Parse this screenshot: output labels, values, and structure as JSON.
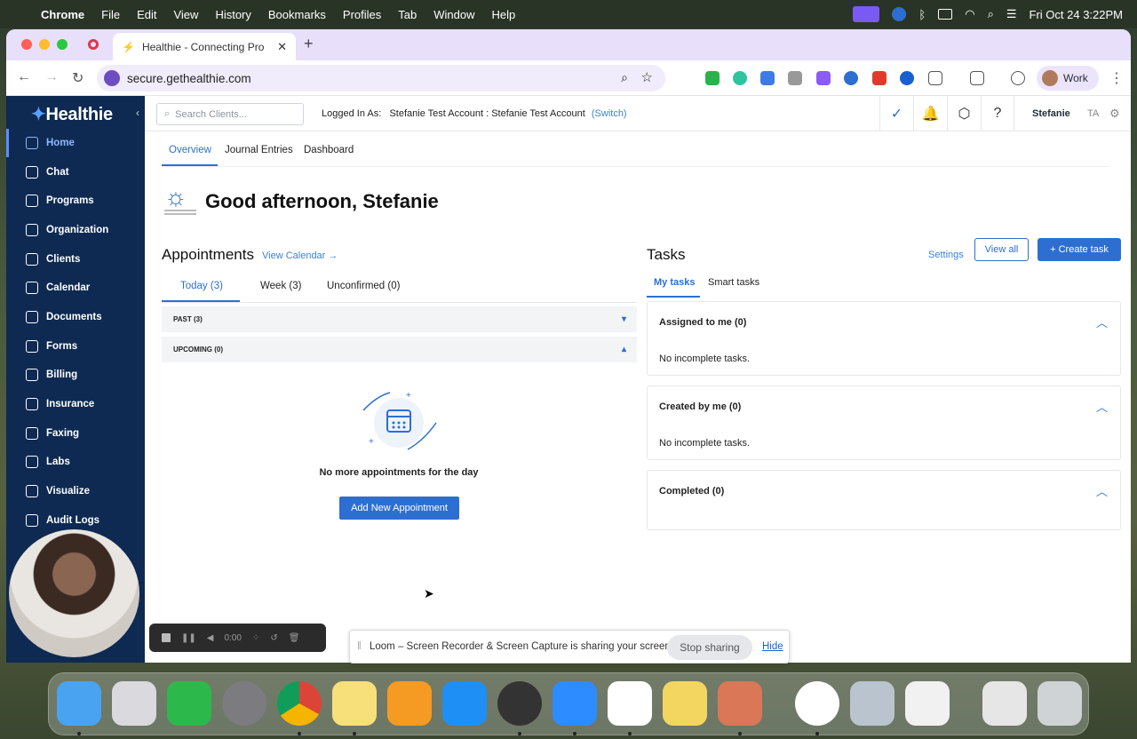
{
  "menubar": {
    "app": "Chrome",
    "items": [
      "File",
      "Edit",
      "View",
      "History",
      "Bookmarks",
      "Profiles",
      "Tab",
      "Window",
      "Help"
    ],
    "clock": "Fri Oct 24  3:22PM"
  },
  "browser": {
    "tab_title": "Healthie - Connecting Pro",
    "url": "secure.gethealthie.com",
    "profile": "Work"
  },
  "sidebar": {
    "logo": "Healthie",
    "items": [
      {
        "label": "Home",
        "icon": "home-icon",
        "active": true
      },
      {
        "label": "Chat",
        "icon": "chat-icon"
      },
      {
        "label": "Programs",
        "icon": "programs-icon"
      },
      {
        "label": "Organization",
        "icon": "organization-icon"
      },
      {
        "label": "Clients",
        "icon": "clients-icon"
      },
      {
        "label": "Calendar",
        "icon": "calendar-icon"
      },
      {
        "label": "Documents",
        "icon": "documents-icon"
      },
      {
        "label": "Forms",
        "icon": "forms-icon"
      },
      {
        "label": "Billing",
        "icon": "billing-icon"
      },
      {
        "label": "Insurance",
        "icon": "insurance-icon"
      },
      {
        "label": "Faxing",
        "icon": "faxing-icon"
      },
      {
        "label": "Labs",
        "icon": "labs-icon"
      },
      {
        "label": "Visualize",
        "icon": "visualize-icon"
      },
      {
        "label": "Audit Logs",
        "icon": "audit-logs-icon"
      }
    ]
  },
  "topbar": {
    "search_placeholder": "Search Clients...",
    "logged_in_label": "Logged In As:",
    "logged_in_account": "Stefanie Test Account : Stefanie Test Account",
    "switch_label": "(Switch)",
    "user_name": "Stefanie",
    "user_initials": "TA"
  },
  "subtabs": [
    "Overview",
    "Journal Entries",
    "Dashboard"
  ],
  "greeting": "Good afternoon, Stefanie",
  "appointments": {
    "title": "Appointments",
    "view_calendar": "View Calendar →",
    "tabs": [
      "Today (3)",
      "Week (3)",
      "Unconfirmed (0)"
    ],
    "past_label": "PAST (3)",
    "upcoming_label": "UPCOMING (0)",
    "empty_text": "No more appointments for the day",
    "add_button": "Add New Appointment"
  },
  "tasks": {
    "title": "Tasks",
    "settings": "Settings",
    "view_all": "View all",
    "create": "+ Create task",
    "tabs": [
      "My tasks",
      "Smart tasks"
    ],
    "sections": [
      {
        "title": "Assigned to me (0)",
        "body": "No incomplete tasks."
      },
      {
        "title": "Created by me (0)",
        "body": "No incomplete tasks."
      },
      {
        "title": "Completed (0)",
        "body": ""
      }
    ]
  },
  "loom": {
    "timer": "0:00",
    "share_text": "Loom – Screen Recorder & Screen Capture is sharing your screen.",
    "stop": "Stop sharing",
    "hide": "Hide"
  },
  "colors": {
    "brand": "#0e2a52",
    "accent": "#2d6fd0"
  }
}
